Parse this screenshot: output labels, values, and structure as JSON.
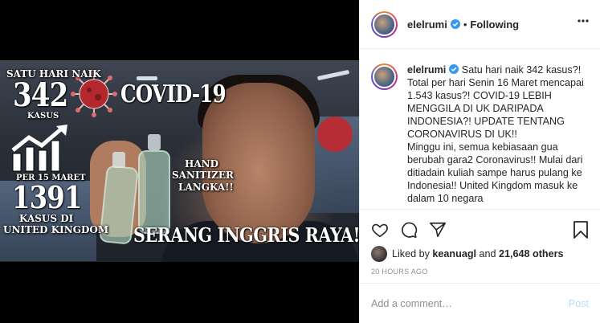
{
  "post": {
    "username": "elelrumi",
    "follow_status": "Following",
    "caption": "Satu hari naik 342 kasus?! Total per hari Senin 16 Maret mencapai 1.543 kasus?! COVID-19 LEBIH MENGGILA DI UK DARIPADA INDONESIA?! UPDATE TENTANG CORONAVIRUS DI UK!!\nMinggu ini, semua kebiasaan gua berubah gara2 Coronavirus!! Mulai dari ditiadain kuliah sampe harus pulang ke Indonesia!! United Kingdom masuk ke dalam 10 negara",
    "liked_prefix": "Liked by",
    "liked_by_user": "keanuagl",
    "liked_and": "and",
    "likes_count": "21,648 others",
    "timestamp": "20 HOURS AGO",
    "comment_placeholder": "Add a comment…",
    "post_button": "Post"
  },
  "thumbnail": {
    "line1": "SATU HARI NAIK",
    "number1": "342",
    "kasus1": "KASUS",
    "covid": "COVID-19",
    "per15": "PER 15 MARET",
    "number2": "1391",
    "kasus_di": "KASUS DI",
    "united_kingdom": "UNITED KINGDOM",
    "hand": "HAND",
    "sanitizer": "SANITIZER",
    "langka": "LANGKA!!",
    "serang": "SERANG INGGRIS RAYA!!"
  },
  "icons": {
    "header_more": "more-horizontal-icon",
    "verified": "verified-badge-icon",
    "like": "heart-icon",
    "comment": "comment-icon",
    "share": "share-icon",
    "save": "bookmark-icon"
  },
  "colors": {
    "verified_blue": "#3897f0",
    "post_button": "#b2dffc",
    "muted": "#8e8e8e",
    "text": "#262626"
  }
}
